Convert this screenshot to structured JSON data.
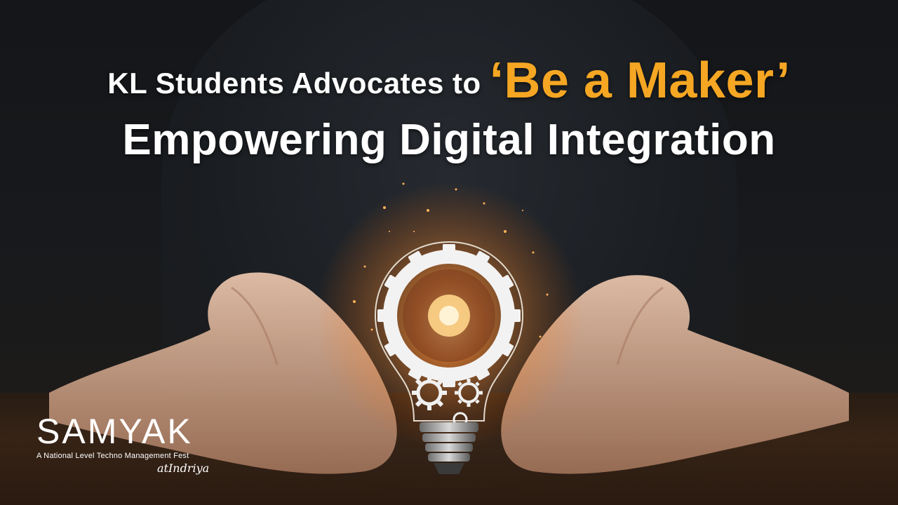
{
  "headline": {
    "line1_prefix": "KL Students Advocates to",
    "line1_highlight": "‘Be a Maker’",
    "line2": "Empowering Digital Integration"
  },
  "logo": {
    "wordmark": "SAMYAK",
    "tagline": "A National Level Techno Management Fest",
    "subbrand": "atIndriya"
  },
  "colors": {
    "highlight": "#f5a623",
    "text": "#ffffff",
    "bulb_glow": "#ffb347"
  },
  "imagery": {
    "subject": "lightbulb-with-gears-icon",
    "hands": "open-hands"
  }
}
